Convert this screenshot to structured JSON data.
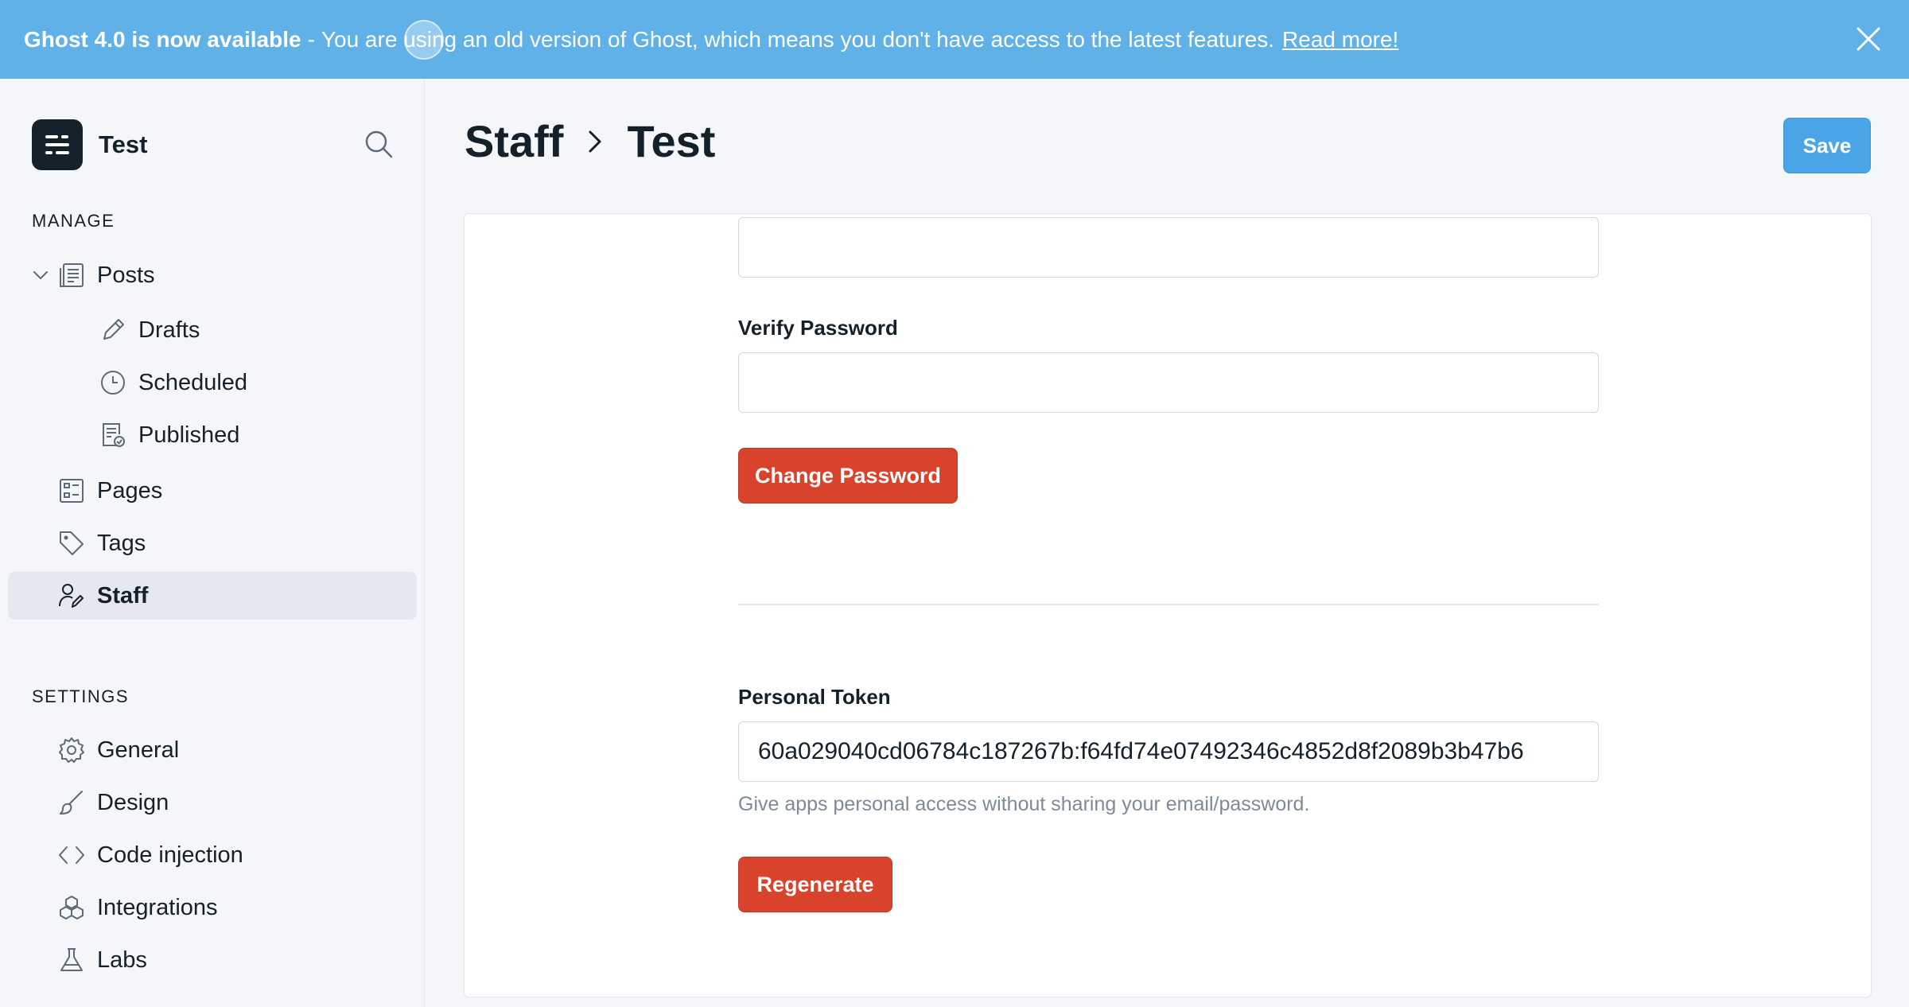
{
  "banner": {
    "strong": "Ghost 4.0 is now available",
    "separator": "-",
    "message": "You are using an old version of Ghost, which means you don't have access to the latest features.",
    "link": "Read more!",
    "close_icon": "close-icon"
  },
  "site": {
    "name": "Test"
  },
  "sidebar": {
    "manage_label": "MANAGE",
    "settings_label": "SETTINGS",
    "manage_items": [
      {
        "label": "Posts",
        "icon": "posts-icon"
      },
      {
        "label": "Drafts",
        "icon": "pencil-icon"
      },
      {
        "label": "Scheduled",
        "icon": "clock-icon"
      },
      {
        "label": "Published",
        "icon": "published-icon"
      },
      {
        "label": "Pages",
        "icon": "pages-icon"
      },
      {
        "label": "Tags",
        "icon": "tag-icon"
      },
      {
        "label": "Staff",
        "icon": "staff-icon",
        "active": true
      }
    ],
    "settings_items": [
      {
        "label": "General",
        "icon": "gear-icon"
      },
      {
        "label": "Design",
        "icon": "brush-icon"
      },
      {
        "label": "Code injection",
        "icon": "code-icon"
      },
      {
        "label": "Integrations",
        "icon": "integrations-icon"
      },
      {
        "label": "Labs",
        "icon": "flask-icon"
      }
    ]
  },
  "header": {
    "crumb_parent": "Staff",
    "crumb_current": "Test",
    "save_label": "Save"
  },
  "form": {
    "new_password_value": "",
    "verify_password_label": "Verify Password",
    "verify_password_value": "",
    "change_password_label": "Change Password",
    "personal_token_label": "Personal Token",
    "personal_token_value": "60a029040cd06784c187267b:f64fd74e07492346c4852d8f2089b3b47b6",
    "personal_token_hint": "Give apps personal access without sharing your email/password.",
    "regenerate_label": "Regenerate"
  },
  "colors": {
    "banner": "#5fb1e7",
    "save_button": "#4aa4e6",
    "danger_button": "#d9432c",
    "sidebar_bg": "#f4f6f9"
  }
}
